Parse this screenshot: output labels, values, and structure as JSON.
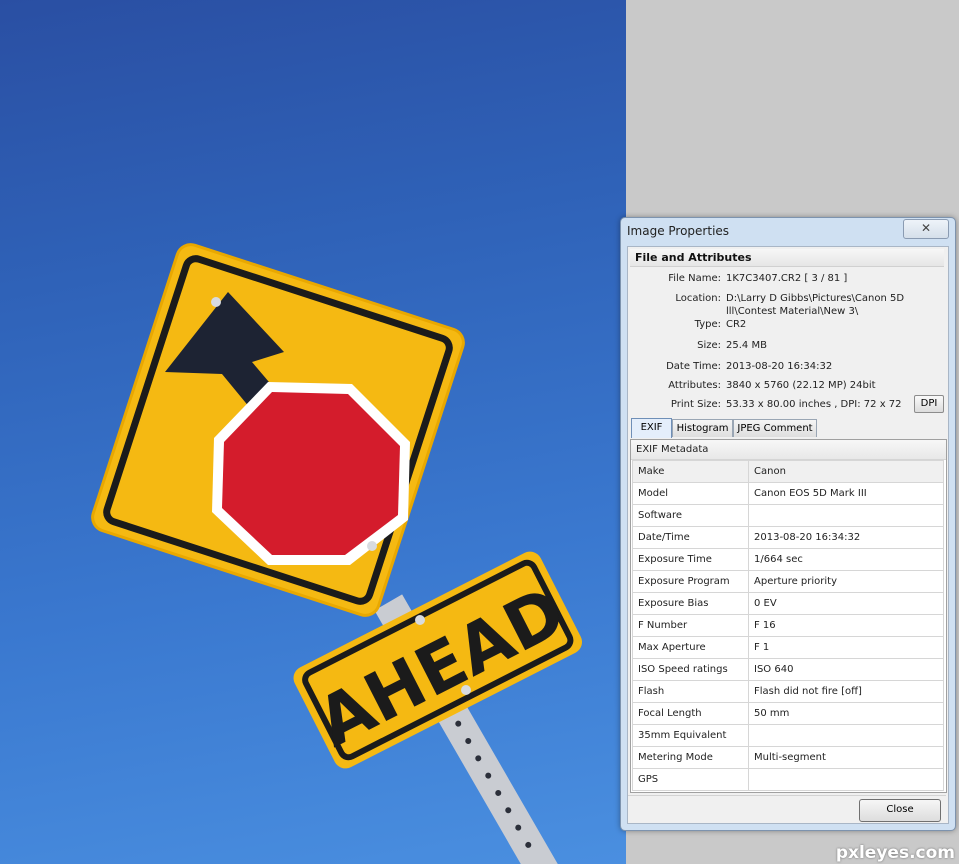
{
  "dialog": {
    "title": "Image Properties",
    "close_glyph": "✕",
    "section_title": "File and Attributes",
    "attributes": [
      {
        "label": "File Name:",
        "value": "1K7C3407.CR2   [ 3 / 81 ]"
      },
      {
        "label": "Location:",
        "value": "D:\\Larry D Gibbs\\Pictures\\Canon 5D",
        "value2": "lll\\Contest Material\\New 3\\"
      },
      {
        "label": "Type:",
        "value": "CR2"
      },
      {
        "label": "Size:",
        "value": "25.4 MB"
      },
      {
        "label": "Date Time:",
        "value": "2013-08-20 16:34:32"
      },
      {
        "label": "Attributes:",
        "value": "3840 x 5760 (22.12 MP)  24bit"
      },
      {
        "label": "Print Size:",
        "value": "53.33 x 80.00 inches ,   DPI: 72 x 72"
      }
    ],
    "dpi_button": "DPI",
    "tabs": [
      "EXIF",
      "Histogram",
      "JPEG Comment"
    ],
    "exif_header": "EXIF Metadata",
    "exif_rows": [
      [
        "Make",
        "Canon"
      ],
      [
        "Model",
        "Canon EOS 5D Mark III"
      ],
      [
        "Software",
        ""
      ],
      [
        "Date/Time",
        "2013-08-20 16:34:32"
      ],
      [
        "Exposure Time",
        "1/664 sec"
      ],
      [
        "Exposure Program",
        "Aperture priority"
      ],
      [
        "Exposure Bias",
        "0 EV"
      ],
      [
        "F Number",
        "F 16"
      ],
      [
        "Max Aperture",
        "F 1"
      ],
      [
        "ISO Speed ratings",
        "ISO 640"
      ],
      [
        "Flash",
        "Flash did not fire [off]"
      ],
      [
        "Focal Length",
        "50 mm"
      ],
      [
        "35mm Equivalent",
        ""
      ],
      [
        "Metering Mode",
        "Multi-segment"
      ],
      [
        "GPS",
        ""
      ]
    ],
    "close_button": "Close"
  },
  "photo": {
    "sign_text": "AHEAD"
  },
  "watermark": "pxleyes.com"
}
